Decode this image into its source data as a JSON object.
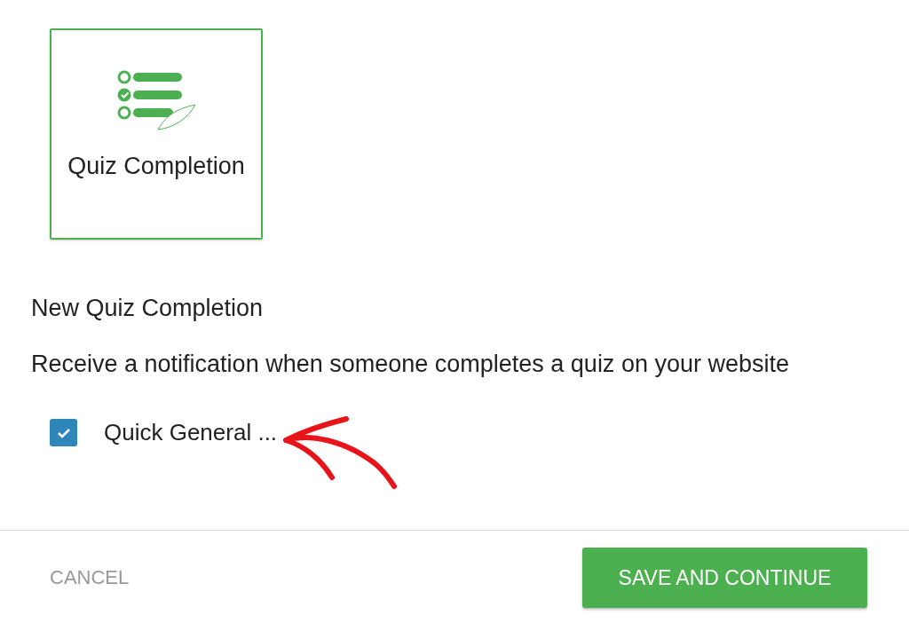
{
  "template_card": {
    "label": "Quiz Completion",
    "selected": true
  },
  "form_title": "New Quiz Completion",
  "description": "Receive a notification when someone completes a quiz on your website",
  "quizzes": [
    {
      "label": "Quick General ...",
      "checked": true
    }
  ],
  "footer": {
    "cancel": "CANCEL",
    "save": "SAVE AND CONTINUE"
  }
}
